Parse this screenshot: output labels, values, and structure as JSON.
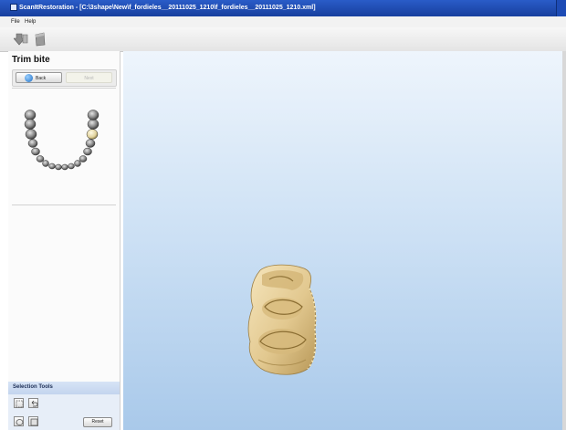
{
  "window": {
    "title": "ScanItRestoration - [C:\\3shape\\New\\f_fordieles__20111025_1210\\f_fordieles__20111025_1210.xml]"
  },
  "menu": {
    "file": "File",
    "help": "Help"
  },
  "toolbar": {
    "icons": [
      "import-icon",
      "export-icon"
    ]
  },
  "panel": {
    "title": "Trim bite",
    "back_label": "Back",
    "next_label": "Next"
  },
  "selection_tools": {
    "title": "Selection Tools",
    "reset_label": "Reset"
  },
  "colors": {
    "titlebar": "#2a5cc8",
    "viewport_top": "#eef5fc",
    "viewport_bottom": "#a9c9ea",
    "model": "#e6cc94"
  }
}
